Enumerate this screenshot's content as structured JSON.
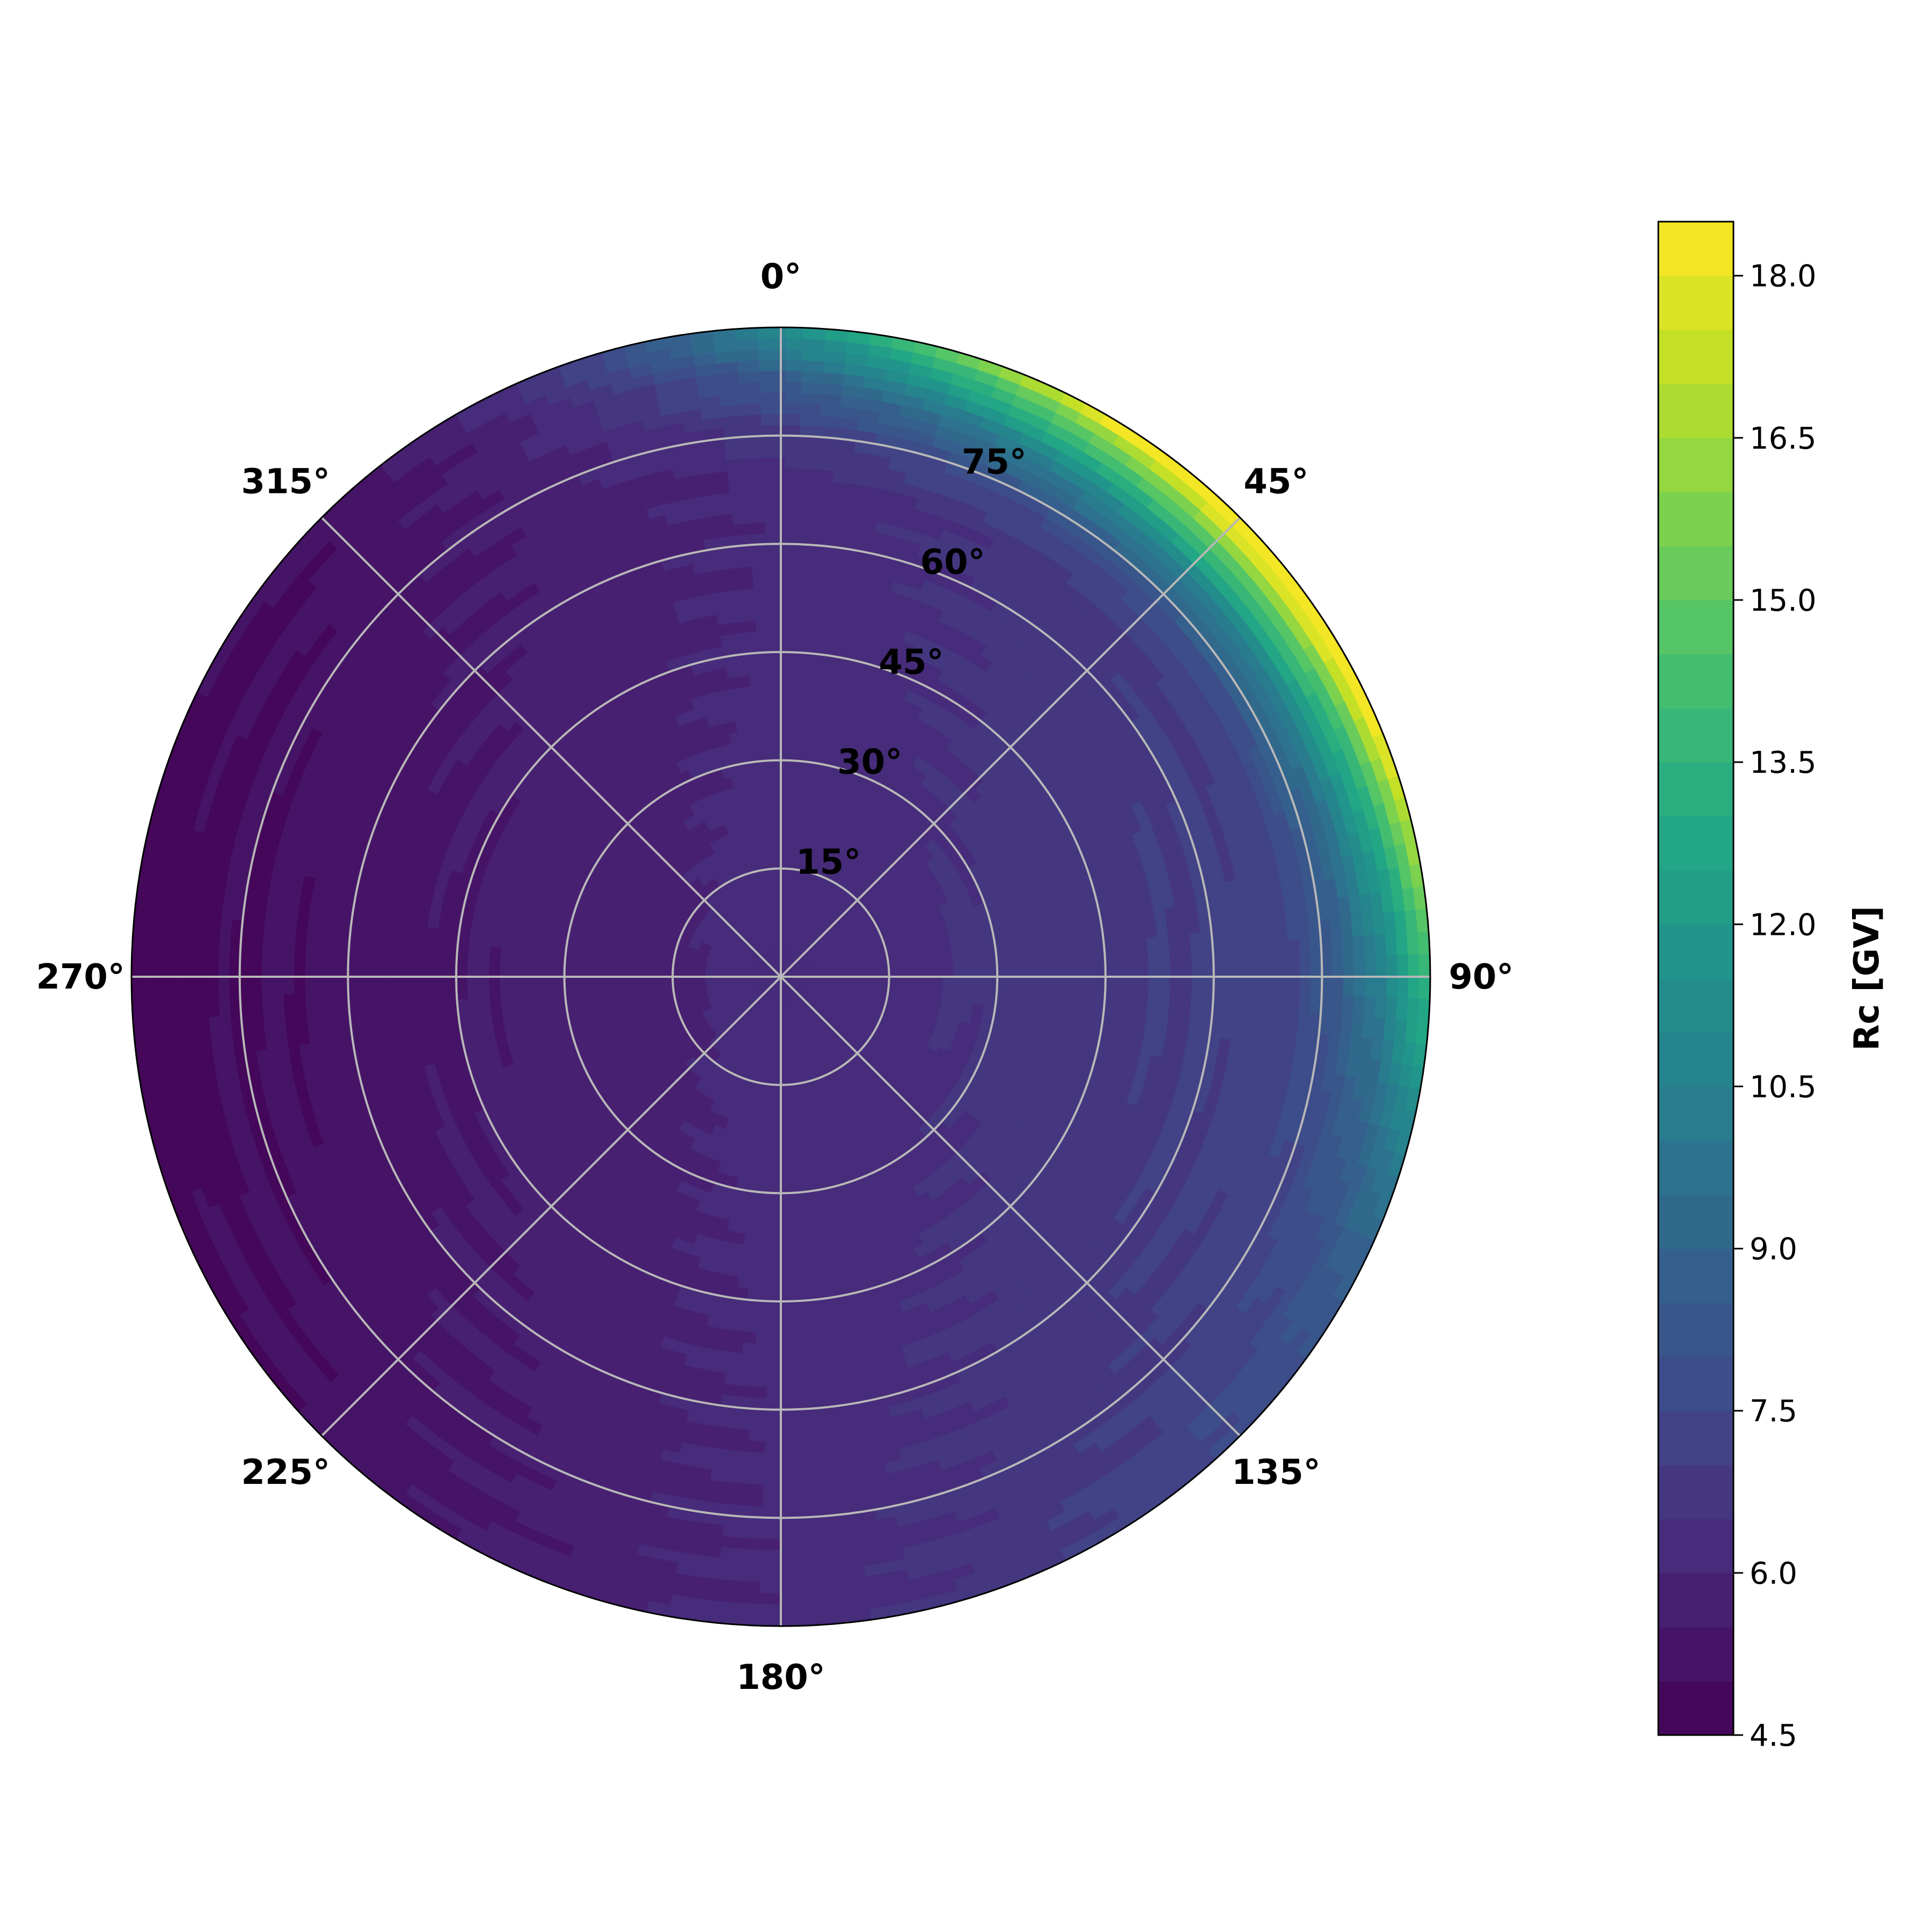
{
  "chart_data": {
    "type": "heatmap",
    "projection": "polar",
    "theta_zero_location": "top",
    "theta_direction": "clockwise",
    "angular_tick_labels": [
      "0°",
      "45°",
      "90°",
      "135°",
      "180°",
      "225°",
      "270°",
      "315°"
    ],
    "angular_ticks_deg": [
      0,
      45,
      90,
      135,
      180,
      225,
      270,
      315
    ],
    "radial_ticks_deg": [
      15,
      30,
      45,
      60,
      75
    ],
    "radial_tick_labels": [
      "15°",
      "30°",
      "45°",
      "60°",
      "75°"
    ],
    "rlim": [
      0,
      90
    ],
    "grid": true,
    "colormap": "viridis",
    "colorbar": {
      "label": "Rc [GV]",
      "range": [
        4.5,
        18.5
      ],
      "levels": 28,
      "ticks": [
        4.5,
        6.0,
        7.5,
        9.0,
        10.5,
        12.0,
        13.5,
        15.0,
        16.5,
        18.0
      ],
      "tick_labels": [
        "4.5",
        "6.0",
        "7.5",
        "9.0",
        "10.5",
        "12.0",
        "13.5",
        "15.0",
        "16.5",
        "18.0"
      ],
      "position": "right"
    },
    "field": {
      "description_values_at_azimuth_zenith": [
        {
          "azimuth": 270,
          "zenith": 85,
          "rc": 4.7
        },
        {
          "azimuth": 270,
          "zenith": 45,
          "rc": 5.2
        },
        {
          "azimuth": 0,
          "zenith": 0,
          "rc": 6.1
        },
        {
          "azimuth": 90,
          "zenith": 45,
          "rc": 7.6
        },
        {
          "azimuth": 90,
          "zenith": 85,
          "rc": 10.0
        },
        {
          "azimuth": 45,
          "zenith": 88,
          "rc": 18.3
        },
        {
          "azimuth": 0,
          "zenith": 88,
          "rc": 10.5
        },
        {
          "azimuth": 180,
          "zenith": 85,
          "rc": 6.2
        },
        {
          "azimuth": 135,
          "zenith": 85,
          "rc": 7.6
        },
        {
          "azimuth": 225,
          "zenith": 85,
          "rc": 5.3
        },
        {
          "azimuth": 315,
          "zenith": 85,
          "rc": 5.2
        }
      ]
    }
  }
}
